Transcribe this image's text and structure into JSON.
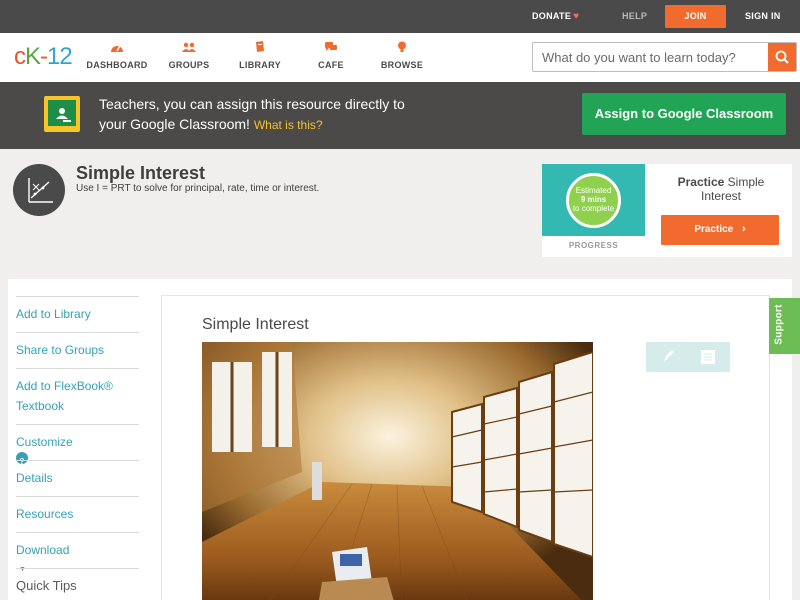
{
  "topbar": {
    "donate": "DONATE",
    "help": "HELP",
    "join": "JOIN",
    "signin": "SIGN IN"
  },
  "logo": {
    "c": "c",
    "k": "K",
    "dash": "-",
    "num": "12"
  },
  "nav": {
    "items": [
      {
        "label": "DASHBOARD"
      },
      {
        "label": "GROUPS"
      },
      {
        "label": "LIBRARY"
      },
      {
        "label": "CAFE"
      },
      {
        "label": "BROWSE"
      }
    ],
    "search_placeholder": "What do you want to learn today?"
  },
  "classroom": {
    "text_line1": "Teachers, you can assign this resource directly to",
    "text_line2": "your Google Classroom!",
    "what_link": "What is this?",
    "assign_button": "Assign to Google Classroom"
  },
  "concept": {
    "title": "Simple Interest",
    "subtitle": "Use I = PRT to solve for principal, rate, time or interest."
  },
  "practice": {
    "estimated": "Estimated",
    "mins": "9 mins",
    "to_complete": "to complete",
    "progress": "PROGRESS",
    "label_bold": "Practice",
    "label_rest": "Simple Interest",
    "button": "Practice"
  },
  "sidebar": {
    "items": [
      {
        "label": "Add to Library"
      },
      {
        "label": "Share to Groups"
      },
      {
        "label": "Add to FlexBook® Textbook"
      },
      {
        "label": "Customize"
      },
      {
        "label": "Details"
      },
      {
        "label": "Resources"
      },
      {
        "label": "Download"
      },
      {
        "label": "Quick Tips"
      }
    ],
    "customize_help": "?",
    "download_caret": "▼"
  },
  "article": {
    "title": "Simple Interest"
  },
  "support": "Support",
  "colors": {
    "brand_orange": "#f26b2e",
    "link_teal": "#35a1b6",
    "google_green": "#21a455",
    "support_green": "#6cbd54"
  }
}
